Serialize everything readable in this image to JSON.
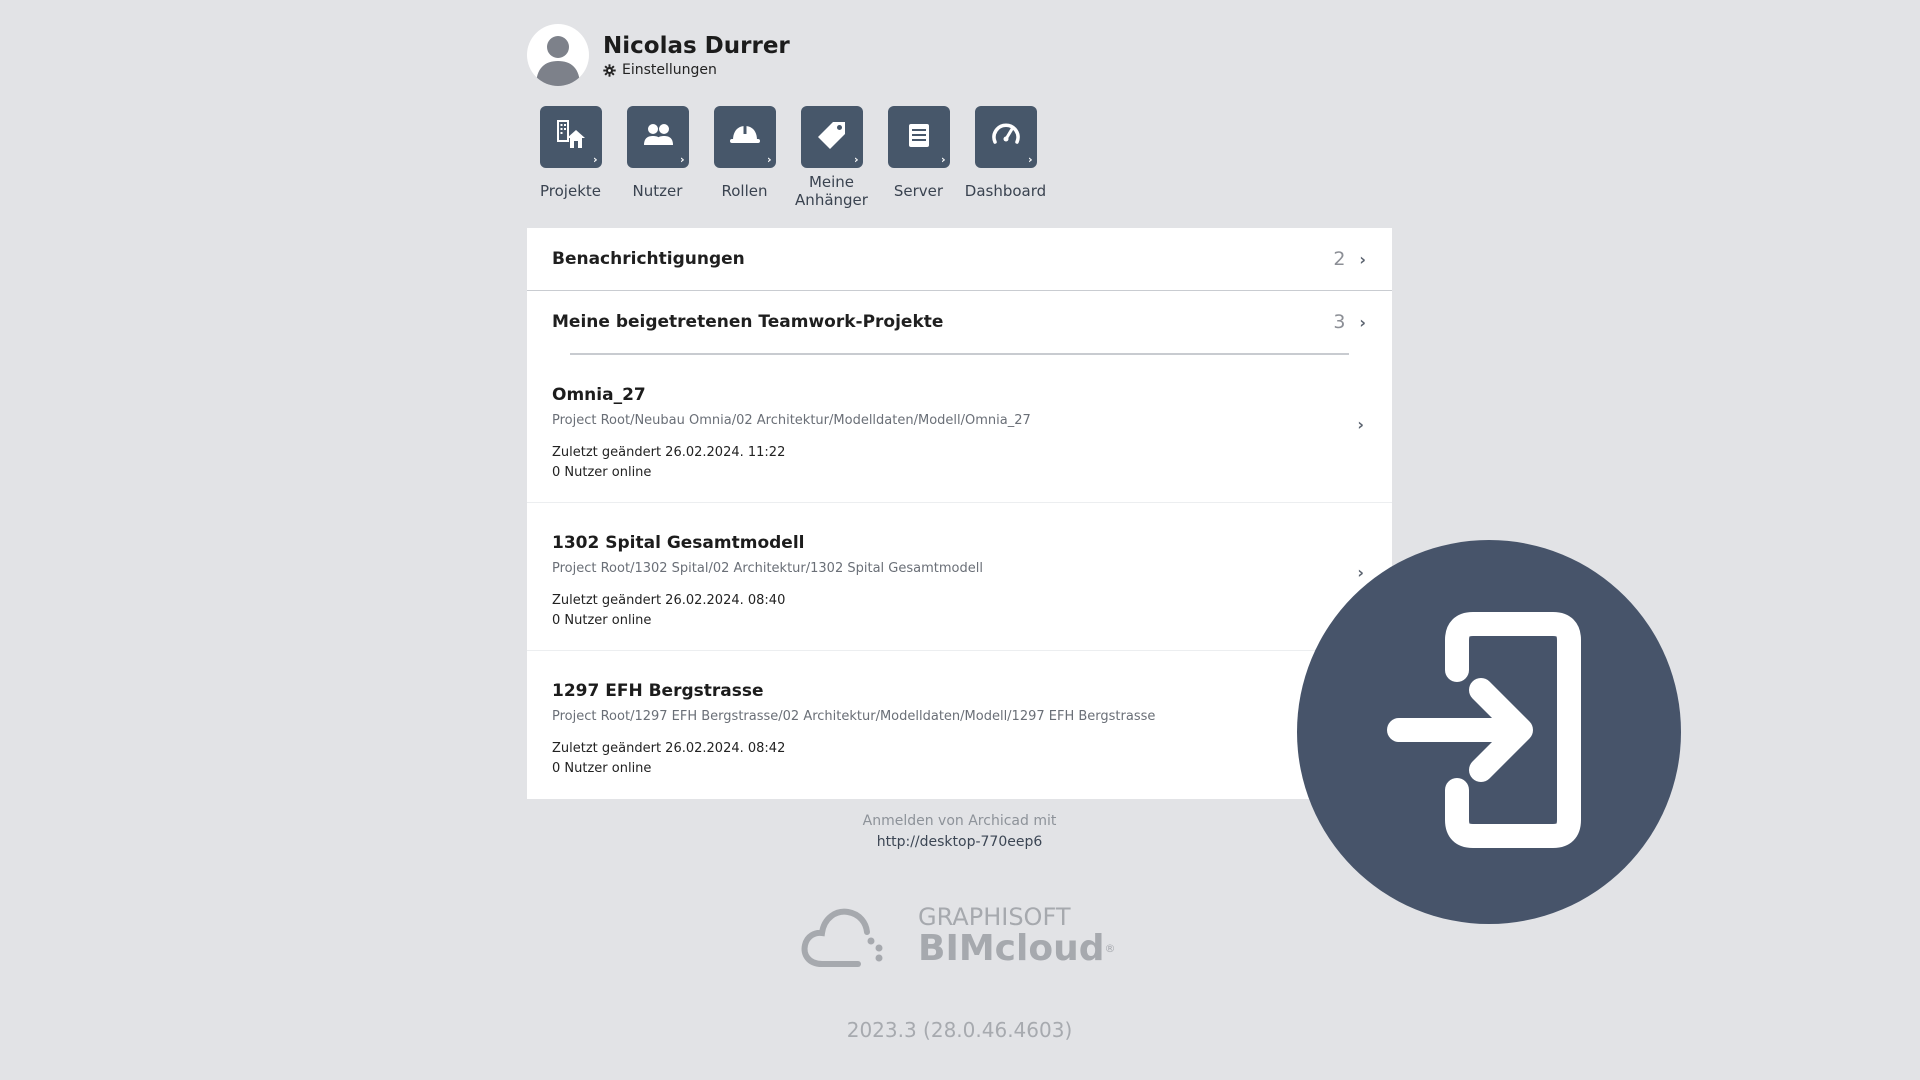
{
  "user": {
    "name": "Nicolas Durrer",
    "settings_label": "Einstellungen",
    "avatar_icon": "user-avatar-icon",
    "settings_icon": "gear-icon"
  },
  "toolbar": {
    "items": [
      {
        "label": "Projekte",
        "icon": "projects-icon"
      },
      {
        "label": "Nutzer",
        "icon": "users-icon"
      },
      {
        "label": "Rollen",
        "icon": "helmet-icon"
      },
      {
        "label": "Meine Anhänger",
        "icon": "tag-icon"
      },
      {
        "label": "Server",
        "icon": "server-icon"
      },
      {
        "label": "Dashboard",
        "icon": "speedometer-icon"
      }
    ]
  },
  "notifications": {
    "title": "Benachrichtigungen",
    "count": "2"
  },
  "teamwork": {
    "title": "Meine beigetretenen Teamwork-Projekte",
    "count": "3",
    "projects": [
      {
        "name": "Omnia_27",
        "path": "Project Root/Neubau Omnia/02 Architektur/Modelldaten/Modell/Omnia_27",
        "modified": "Zuletzt geändert 26.02.2024. 11:22",
        "users_online": "0 Nutzer online"
      },
      {
        "name": "1302 Spital Gesamtmodell",
        "path": "Project Root/1302 Spital/02 Architektur/1302 Spital Gesamtmodell",
        "modified": "Zuletzt geändert 26.02.2024. 08:40",
        "users_online": "0 Nutzer online"
      },
      {
        "name": "1297 EFH Bergstrasse",
        "path": "Project Root/1297 EFH Bergstrasse/02 Architektur/Modelldaten/Modell/1297 EFH Bergstrasse",
        "modified": "Zuletzt geändert 26.02.2024. 08:42",
        "users_online": "0 Nutzer online"
      }
    ]
  },
  "footer": {
    "login_note": "Anmelden von Archicad mit",
    "login_url": "http://desktop-770eep6",
    "brand": "GRAPHISOFT",
    "product": "BIMcloud",
    "trademark": "®",
    "version": "2023.3 (28.0.46.4603)"
  },
  "overlay": {
    "icon": "login-icon"
  },
  "colors": {
    "background": "#e2e3e6",
    "accent": "#47576a",
    "panel": "#ffffff"
  }
}
